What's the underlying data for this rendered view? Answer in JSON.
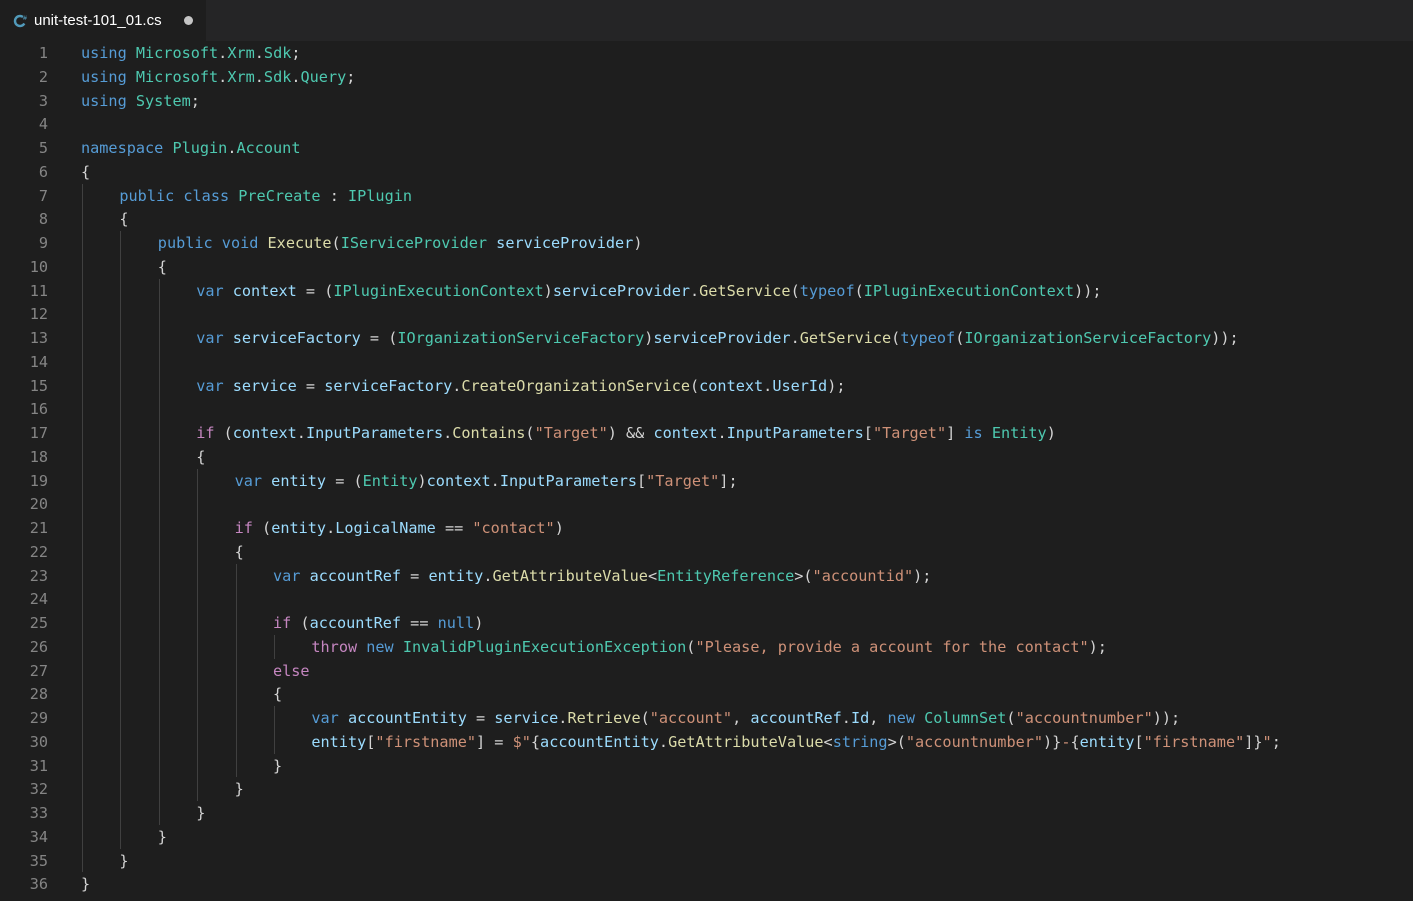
{
  "tab": {
    "title": "unit-test-101_01.cs",
    "icon": "csharp-file-icon",
    "dirty": true
  },
  "colors": {
    "background": "#1e1e1e",
    "tabbar": "#252526",
    "line_number": "#858585",
    "keyword": "#569cd6",
    "control": "#c586c0",
    "type": "#4ec9b0",
    "function": "#dcdcaa",
    "variable": "#9cdcfe",
    "string": "#ce9178",
    "punctuation": "#d4d4d4"
  },
  "lines": [
    {
      "n": "1",
      "indent": 0,
      "tokens": [
        [
          "kw",
          "using "
        ],
        [
          "ty",
          "Microsoft"
        ],
        [
          "pn",
          "."
        ],
        [
          "ty",
          "Xrm"
        ],
        [
          "pn",
          "."
        ],
        [
          "ty",
          "Sdk"
        ],
        [
          "pn",
          ";"
        ]
      ]
    },
    {
      "n": "2",
      "indent": 0,
      "tokens": [
        [
          "kw",
          "using "
        ],
        [
          "ty",
          "Microsoft"
        ],
        [
          "pn",
          "."
        ],
        [
          "ty",
          "Xrm"
        ],
        [
          "pn",
          "."
        ],
        [
          "ty",
          "Sdk"
        ],
        [
          "pn",
          "."
        ],
        [
          "ty",
          "Query"
        ],
        [
          "pn",
          ";"
        ]
      ]
    },
    {
      "n": "3",
      "indent": 0,
      "tokens": [
        [
          "kw",
          "using "
        ],
        [
          "ty",
          "System"
        ],
        [
          "pn",
          ";"
        ]
      ]
    },
    {
      "n": "4",
      "indent": 0,
      "tokens": []
    },
    {
      "n": "5",
      "indent": 0,
      "tokens": [
        [
          "kw",
          "namespace "
        ],
        [
          "ty",
          "Plugin"
        ],
        [
          "pn",
          "."
        ],
        [
          "ty",
          "Account"
        ]
      ]
    },
    {
      "n": "6",
      "indent": 0,
      "tokens": [
        [
          "pn",
          "{"
        ]
      ]
    },
    {
      "n": "7",
      "indent": 1,
      "tokens": [
        [
          "kw",
          "public class "
        ],
        [
          "ty",
          "PreCreate"
        ],
        [
          "pn",
          " : "
        ],
        [
          "ty",
          "IPlugin"
        ]
      ]
    },
    {
      "n": "8",
      "indent": 1,
      "tokens": [
        [
          "pn",
          "{"
        ]
      ]
    },
    {
      "n": "9",
      "indent": 2,
      "tokens": [
        [
          "kw",
          "public void "
        ],
        [
          "fn",
          "Execute"
        ],
        [
          "pn",
          "("
        ],
        [
          "ty",
          "IServiceProvider"
        ],
        [
          "pn",
          " "
        ],
        [
          "vr",
          "serviceProvider"
        ],
        [
          "pn",
          ")"
        ]
      ]
    },
    {
      "n": "10",
      "indent": 2,
      "tokens": [
        [
          "pn",
          "{"
        ]
      ]
    },
    {
      "n": "11",
      "indent": 3,
      "tokens": [
        [
          "kw",
          "var "
        ],
        [
          "vr",
          "context"
        ],
        [
          "pn",
          " = ("
        ],
        [
          "ty",
          "IPluginExecutionContext"
        ],
        [
          "pn",
          ")"
        ],
        [
          "vr",
          "serviceProvider"
        ],
        [
          "pn",
          "."
        ],
        [
          "fn",
          "GetService"
        ],
        [
          "pn",
          "("
        ],
        [
          "kw",
          "typeof"
        ],
        [
          "pn",
          "("
        ],
        [
          "ty",
          "IPluginExecutionContext"
        ],
        [
          "pn",
          "));"
        ]
      ]
    },
    {
      "n": "12",
      "indent": 3,
      "tokens": []
    },
    {
      "n": "13",
      "indent": 3,
      "tokens": [
        [
          "kw",
          "var "
        ],
        [
          "vr",
          "serviceFactory"
        ],
        [
          "pn",
          " = ("
        ],
        [
          "ty",
          "IOrganizationServiceFactory"
        ],
        [
          "pn",
          ")"
        ],
        [
          "vr",
          "serviceProvider"
        ],
        [
          "pn",
          "."
        ],
        [
          "fn",
          "GetService"
        ],
        [
          "pn",
          "("
        ],
        [
          "kw",
          "typeof"
        ],
        [
          "pn",
          "("
        ],
        [
          "ty",
          "IOrganizationServiceFactory"
        ],
        [
          "pn",
          "));"
        ]
      ]
    },
    {
      "n": "14",
      "indent": 3,
      "tokens": []
    },
    {
      "n": "15",
      "indent": 3,
      "tokens": [
        [
          "kw",
          "var "
        ],
        [
          "vr",
          "service"
        ],
        [
          "pn",
          " = "
        ],
        [
          "vr",
          "serviceFactory"
        ],
        [
          "pn",
          "."
        ],
        [
          "fn",
          "CreateOrganizationService"
        ],
        [
          "pn",
          "("
        ],
        [
          "vr",
          "context"
        ],
        [
          "pn",
          "."
        ],
        [
          "vr",
          "UserId"
        ],
        [
          "pn",
          ");"
        ]
      ]
    },
    {
      "n": "16",
      "indent": 3,
      "tokens": []
    },
    {
      "n": "17",
      "indent": 3,
      "tokens": [
        [
          "ctl",
          "if "
        ],
        [
          "pn",
          "("
        ],
        [
          "vr",
          "context"
        ],
        [
          "pn",
          "."
        ],
        [
          "vr",
          "InputParameters"
        ],
        [
          "pn",
          "."
        ],
        [
          "fn",
          "Contains"
        ],
        [
          "pn",
          "("
        ],
        [
          "st",
          "\"Target\""
        ],
        [
          "pn",
          ") && "
        ],
        [
          "vr",
          "context"
        ],
        [
          "pn",
          "."
        ],
        [
          "vr",
          "InputParameters"
        ],
        [
          "pn",
          "["
        ],
        [
          "st",
          "\"Target\""
        ],
        [
          "pn",
          "] "
        ],
        [
          "kw",
          "is "
        ],
        [
          "ty",
          "Entity"
        ],
        [
          "pn",
          ")"
        ]
      ]
    },
    {
      "n": "18",
      "indent": 3,
      "tokens": [
        [
          "pn",
          "{"
        ]
      ]
    },
    {
      "n": "19",
      "indent": 4,
      "tokens": [
        [
          "kw",
          "var "
        ],
        [
          "vr",
          "entity"
        ],
        [
          "pn",
          " = ("
        ],
        [
          "ty",
          "Entity"
        ],
        [
          "pn",
          ")"
        ],
        [
          "vr",
          "context"
        ],
        [
          "pn",
          "."
        ],
        [
          "vr",
          "InputParameters"
        ],
        [
          "pn",
          "["
        ],
        [
          "st",
          "\"Target\""
        ],
        [
          "pn",
          "];"
        ]
      ]
    },
    {
      "n": "20",
      "indent": 4,
      "tokens": []
    },
    {
      "n": "21",
      "indent": 4,
      "tokens": [
        [
          "ctl",
          "if "
        ],
        [
          "pn",
          "("
        ],
        [
          "vr",
          "entity"
        ],
        [
          "pn",
          "."
        ],
        [
          "vr",
          "LogicalName"
        ],
        [
          "pn",
          " == "
        ],
        [
          "st",
          "\"contact\""
        ],
        [
          "pn",
          ")"
        ]
      ]
    },
    {
      "n": "22",
      "indent": 4,
      "tokens": [
        [
          "pn",
          "{"
        ]
      ]
    },
    {
      "n": "23",
      "indent": 5,
      "tokens": [
        [
          "kw",
          "var "
        ],
        [
          "vr",
          "accountRef"
        ],
        [
          "pn",
          " = "
        ],
        [
          "vr",
          "entity"
        ],
        [
          "pn",
          "."
        ],
        [
          "fn",
          "GetAttributeValue"
        ],
        [
          "pn",
          "<"
        ],
        [
          "ty",
          "EntityReference"
        ],
        [
          "pn",
          ">("
        ],
        [
          "st",
          "\"accountid\""
        ],
        [
          "pn",
          ");"
        ]
      ]
    },
    {
      "n": "24",
      "indent": 5,
      "tokens": []
    },
    {
      "n": "25",
      "indent": 5,
      "tokens": [
        [
          "ctl",
          "if "
        ],
        [
          "pn",
          "("
        ],
        [
          "vr",
          "accountRef"
        ],
        [
          "pn",
          " == "
        ],
        [
          "kw",
          "null"
        ],
        [
          "pn",
          ")"
        ]
      ]
    },
    {
      "n": "26",
      "indent": 6,
      "tokens": [
        [
          "ctl",
          "throw "
        ],
        [
          "kw",
          "new "
        ],
        [
          "ty",
          "InvalidPluginExecutionException"
        ],
        [
          "pn",
          "("
        ],
        [
          "st",
          "\"Please, provide a account for the contact\""
        ],
        [
          "pn",
          ");"
        ]
      ]
    },
    {
      "n": "27",
      "indent": 5,
      "tokens": [
        [
          "ctl",
          "else"
        ]
      ]
    },
    {
      "n": "28",
      "indent": 5,
      "tokens": [
        [
          "pn",
          "{"
        ]
      ]
    },
    {
      "n": "29",
      "indent": 6,
      "tokens": [
        [
          "kw",
          "var "
        ],
        [
          "vr",
          "accountEntity"
        ],
        [
          "pn",
          " = "
        ],
        [
          "vr",
          "service"
        ],
        [
          "pn",
          "."
        ],
        [
          "fn",
          "Retrieve"
        ],
        [
          "pn",
          "("
        ],
        [
          "st",
          "\"account\""
        ],
        [
          "pn",
          ", "
        ],
        [
          "vr",
          "accountRef"
        ],
        [
          "pn",
          "."
        ],
        [
          "vr",
          "Id"
        ],
        [
          "pn",
          ", "
        ],
        [
          "kw",
          "new "
        ],
        [
          "ty",
          "ColumnSet"
        ],
        [
          "pn",
          "("
        ],
        [
          "st",
          "\"accountnumber\""
        ],
        [
          "pn",
          "));"
        ]
      ]
    },
    {
      "n": "30",
      "indent": 6,
      "tokens": [
        [
          "vr",
          "entity"
        ],
        [
          "pn",
          "["
        ],
        [
          "st",
          "\"firstname\""
        ],
        [
          "pn",
          "] = "
        ],
        [
          "st",
          "$\""
        ],
        [
          "pn",
          "{"
        ],
        [
          "vr",
          "accountEntity"
        ],
        [
          "pn",
          "."
        ],
        [
          "fn",
          "GetAttributeValue"
        ],
        [
          "pn",
          "<"
        ],
        [
          "kw",
          "string"
        ],
        [
          "pn",
          ">("
        ],
        [
          "st",
          "\"accountnumber\""
        ],
        [
          "pn",
          ")}"
        ],
        [
          "st",
          "-"
        ],
        [
          "pn",
          "{"
        ],
        [
          "vr",
          "entity"
        ],
        [
          "pn",
          "["
        ],
        [
          "st",
          "\"firstname\""
        ],
        [
          "pn",
          "]}"
        ],
        [
          "st",
          "\""
        ],
        [
          "pn",
          ";"
        ]
      ]
    },
    {
      "n": "31",
      "indent": 5,
      "tokens": [
        [
          "pn",
          "}"
        ]
      ]
    },
    {
      "n": "32",
      "indent": 4,
      "tokens": [
        [
          "pn",
          "}"
        ]
      ]
    },
    {
      "n": "33",
      "indent": 3,
      "tokens": [
        [
          "pn",
          "}"
        ]
      ]
    },
    {
      "n": "34",
      "indent": 2,
      "tokens": [
        [
          "pn",
          "}"
        ]
      ]
    },
    {
      "n": "35",
      "indent": 1,
      "tokens": [
        [
          "pn",
          "}"
        ]
      ]
    },
    {
      "n": "36",
      "indent": 0,
      "tokens": [
        [
          "pn",
          "}"
        ]
      ]
    }
  ]
}
